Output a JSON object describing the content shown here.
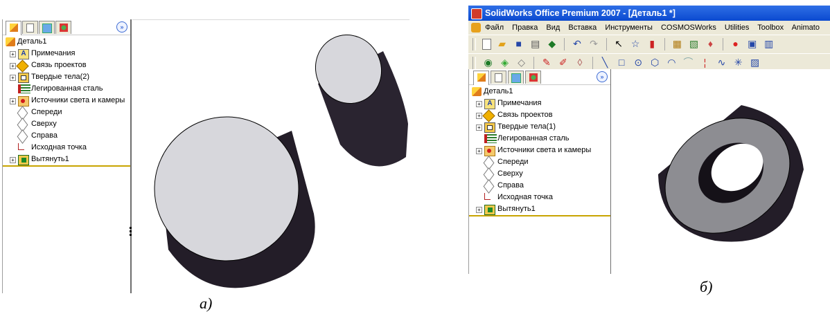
{
  "panel_a": {
    "caption": "а)",
    "tree": {
      "root": "Деталь1",
      "items": [
        {
          "label": "Примечания",
          "icon": "notes-icon",
          "expandable": true
        },
        {
          "label": "Связь проектов",
          "icon": "design-binder-icon",
          "expandable": true
        },
        {
          "label": "Твердые тела(2)",
          "icon": "solid-bodies-icon",
          "expandable": true
        },
        {
          "label": "Легированная сталь",
          "icon": "material-icon",
          "expandable": false
        },
        {
          "label": "Источники света и камеры",
          "icon": "lights-cameras-icon",
          "expandable": true
        },
        {
          "label": "Спереди",
          "icon": "plane-icon",
          "expandable": false
        },
        {
          "label": "Сверху",
          "icon": "plane-icon",
          "expandable": false
        },
        {
          "label": "Справа",
          "icon": "plane-icon",
          "expandable": false
        },
        {
          "label": "Исходная точка",
          "icon": "origin-icon",
          "expandable": false
        },
        {
          "label": "Вытянуть1",
          "icon": "extrude-icon",
          "expandable": true
        }
      ]
    }
  },
  "panel_b": {
    "caption": "б)",
    "window_title": "SolidWorks Office Premium 2007 - [Деталь1 *]",
    "menu": [
      "Файл",
      "Правка",
      "Вид",
      "Вставка",
      "Инструменты",
      "COSMOSWorks",
      "Utilities",
      "Toolbox",
      "Animato"
    ],
    "tree": {
      "root": "Деталь1",
      "items": [
        {
          "label": "Примечания",
          "icon": "notes-icon",
          "expandable": true
        },
        {
          "label": "Связь проектов",
          "icon": "design-binder-icon",
          "expandable": true
        },
        {
          "label": "Твердые тела(1)",
          "icon": "solid-bodies-icon",
          "expandable": true
        },
        {
          "label": "Легированная сталь",
          "icon": "material-icon",
          "expandable": false
        },
        {
          "label": "Источники света и камеры",
          "icon": "lights-cameras-icon",
          "expandable": true
        },
        {
          "label": "Спереди",
          "icon": "plane-icon",
          "expandable": false
        },
        {
          "label": "Сверху",
          "icon": "plane-icon",
          "expandable": false
        },
        {
          "label": "Справа",
          "icon": "plane-icon",
          "expandable": false
        },
        {
          "label": "Исходная точка",
          "icon": "origin-icon",
          "expandable": false
        },
        {
          "label": "Вытянуть1",
          "icon": "extrude-icon",
          "expandable": true
        }
      ]
    }
  },
  "tabs": [
    "featuremanager-tab",
    "propertymanager-tab",
    "configurationmanager-tab",
    "dimxpert-tab"
  ],
  "expand_glyph": "»",
  "colors": {
    "titlebar": "#0b4ad0",
    "cylinder_top": "#d7d7dc",
    "cylinder_side": "#2a2430",
    "tree_end_line": "#c8a400"
  }
}
